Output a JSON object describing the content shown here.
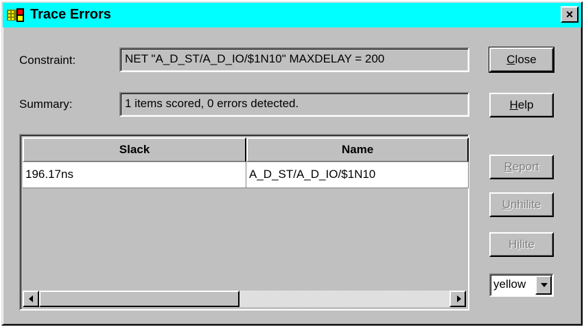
{
  "window": {
    "title": "Trace Errors",
    "icon": "trace-errors-app-icon",
    "close_glyph": "×"
  },
  "constraint": {
    "label": "Constraint:",
    "value": "NET \"A_D_ST/A_D_IO/$1N10\" MAXDELAY = 200"
  },
  "summary": {
    "label": "Summary:",
    "value": "1 items scored, 0 errors detected."
  },
  "buttons": {
    "close": {
      "pre": "",
      "key": "C",
      "post": "lose",
      "enabled": true
    },
    "help": {
      "pre": "",
      "key": "H",
      "post": "elp",
      "enabled": true
    },
    "report": {
      "pre": "",
      "key": "R",
      "post": "eport",
      "enabled": false
    },
    "unhilite": {
      "pre": "",
      "key": "U",
      "post": "nhilite",
      "enabled": false
    },
    "hilite": {
      "pre": "H",
      "key": "i",
      "post": "lite",
      "enabled": false
    }
  },
  "table": {
    "columns": [
      "Slack",
      "Name"
    ],
    "rows": [
      {
        "slack": "196.17ns",
        "name": "A_D_ST/A_D_IO/$1N10"
      }
    ]
  },
  "color_select": {
    "value": "yellow"
  },
  "colors": {
    "title_bar": "#00ffff",
    "face": "#c0c0c0",
    "disabled_text": "#808080"
  }
}
